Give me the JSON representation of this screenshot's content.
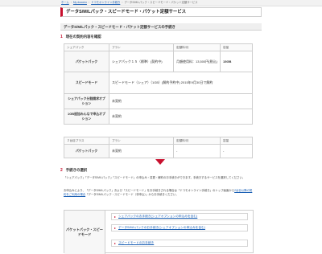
{
  "breadcrumb": {
    "items": [
      "ホーム",
      "My docomo",
      "ドコモオンライン手続き",
      "データS/M/Lパック・スピードモード・パケット定額サービス"
    ]
  },
  "page": {
    "title": "データS/M/Lパック・スピードモード・パケット定額サービス",
    "subtitle": "データS/M/Lパック・スピードモード・パケット定額サービスの手続き"
  },
  "section1": {
    "num": "1",
    "heading": "現在の契約内容を確認"
  },
  "table1": {
    "headers": [
      "シェアパック",
      "プラン",
      "定額料/月",
      "容量"
    ],
    "rows": [
      {
        "label": "パケットパック",
        "plan": "シェアパック１５（標準）(契約中)",
        "fee": "月額使用料：13,500円(税込)",
        "cap": "15GB"
      },
      {
        "label": "スピードモード",
        "plan": "スピードモード（シェア）（1GB）(解約予約中) 2015年9月30日で解約",
        "fee": "",
        "cap": ""
      },
      {
        "label": "シェアパック分割請求オプション",
        "plan": "未契約",
        "fee": "",
        "cap": ""
      },
      {
        "label": "1GB追加みんなで申込オプション",
        "plan": "未契約",
        "fee": "",
        "cap": ""
      }
    ]
  },
  "table2": {
    "headers": [
      "２台目プラス",
      "プラン",
      "定額料/月",
      "容量"
    ],
    "rows": [
      {
        "label": "パケットパック",
        "plan": "未契約",
        "fee": "-",
        "cap": "-"
      }
    ]
  },
  "section2": {
    "num": "2",
    "heading": "手続きの選択"
  },
  "para1": "「シェアパック」「データS/M/Lパック」「スピードモード」の申込み・変更・解約のお手続きができます。手続きするサービスを選択してください。",
  "para2_a": "お申込みにより、「データS/M/Lパック」および「スピードモード」をお手続きされる場合は「ドコモオンライン手続き」のトップ画面から",
  "para2_link": "2台目以降の契約をご利用の場合",
  "para2_b": "「データS/M/Lパック・スピードモード（非申込）」からお手続きください。",
  "procedures": {
    "label": "パケットパック・スピードモード",
    "buttons": [
      {
        "text": "シェアパックのお手続き(シェアオプションの申込みを含む)"
      },
      {
        "text": "データS/M/Lパックのお手続き(シェアオプションの申込みを含む)"
      },
      {
        "text": "スピードモードのお手続き"
      }
    ]
  },
  "colors": {
    "accent": "#c8102e",
    "link": "#1a5fb4",
    "header_bg": "#f7f7f7"
  }
}
